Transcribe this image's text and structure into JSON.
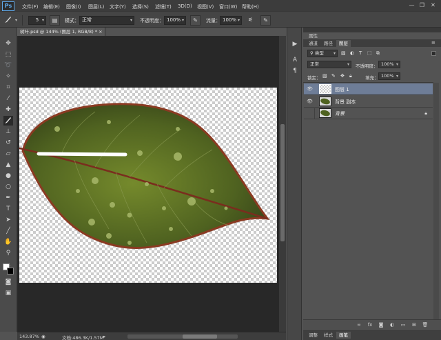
{
  "app": {
    "logo": "Ps"
  },
  "menu": [
    "文件(F)",
    "编辑(E)",
    "图像(I)",
    "图层(L)",
    "文字(Y)",
    "选择(S)",
    "滤镜(T)",
    "3D(D)",
    "视图(V)",
    "窗口(W)",
    "帮助(H)"
  ],
  "window_buttons": {
    "minimize": "—",
    "restore": "❐",
    "close": "✕"
  },
  "options": {
    "brush_size": "5",
    "mode_label": "模式：",
    "mode_value": "正常",
    "opacity_label": "不透明度：",
    "opacity_value": "100%",
    "flow_label": "流量：",
    "flow_value": "100%"
  },
  "document": {
    "tab_title": "树叶.psd @ 144% (图层 1, RGB/8) *",
    "tab_close": "×",
    "zoom": "143.87%",
    "doc_info": "文档:486.3K/1.57M"
  },
  "panel": {
    "tabs_top": [
      "属性"
    ],
    "tabs": [
      "通道",
      "路径",
      "图层"
    ],
    "active_tab": "图层",
    "filter_label": "类型",
    "blend_mode": "正常",
    "opacity_label": "不透明度：",
    "opacity_value": "100%",
    "lock_label": "锁定：",
    "fill_label": "填充：",
    "fill_value": "100%",
    "bottom_tabs": [
      "调整",
      "样式",
      "画笔"
    ]
  },
  "layers": [
    {
      "name": "图层 1",
      "selected": true,
      "visible": true,
      "type": "transparent"
    },
    {
      "name": "背景 副本",
      "selected": false,
      "visible": true,
      "type": "leaf"
    },
    {
      "name": "背景",
      "selected": false,
      "visible": false,
      "type": "leaf",
      "locked": true,
      "italic": true
    }
  ],
  "colors": {
    "accent": "#6e7d97",
    "ps_blue": "#5fa8e8",
    "leaf_dark": "#3d4d1c",
    "leaf_light": "#6f7f24",
    "leaf_edge": "#8a2f1e",
    "stroke": "#ffffff"
  }
}
